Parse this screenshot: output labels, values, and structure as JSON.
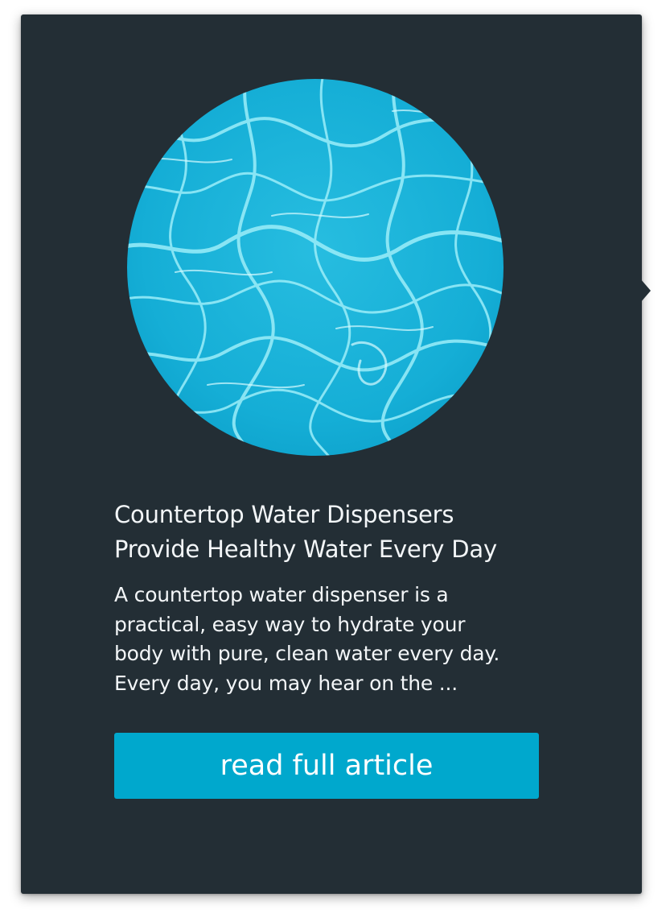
{
  "article": {
    "title": "Countertop Water Dispensers\nProvide Healthy Water Every Day",
    "excerpt": "A countertop water dispenser is a\npractical, easy way to hydrate your\nbody with pure, clean water every day.\nEvery day, you may hear on the ...",
    "image": "pool-water-photo",
    "button_label": "read full article"
  },
  "colors": {
    "card_background": "#232e35",
    "button": "#00a8cd",
    "water_base": "#18b2d8",
    "water_highlight": "#a9f2fa",
    "text": "#f3f6f8"
  }
}
